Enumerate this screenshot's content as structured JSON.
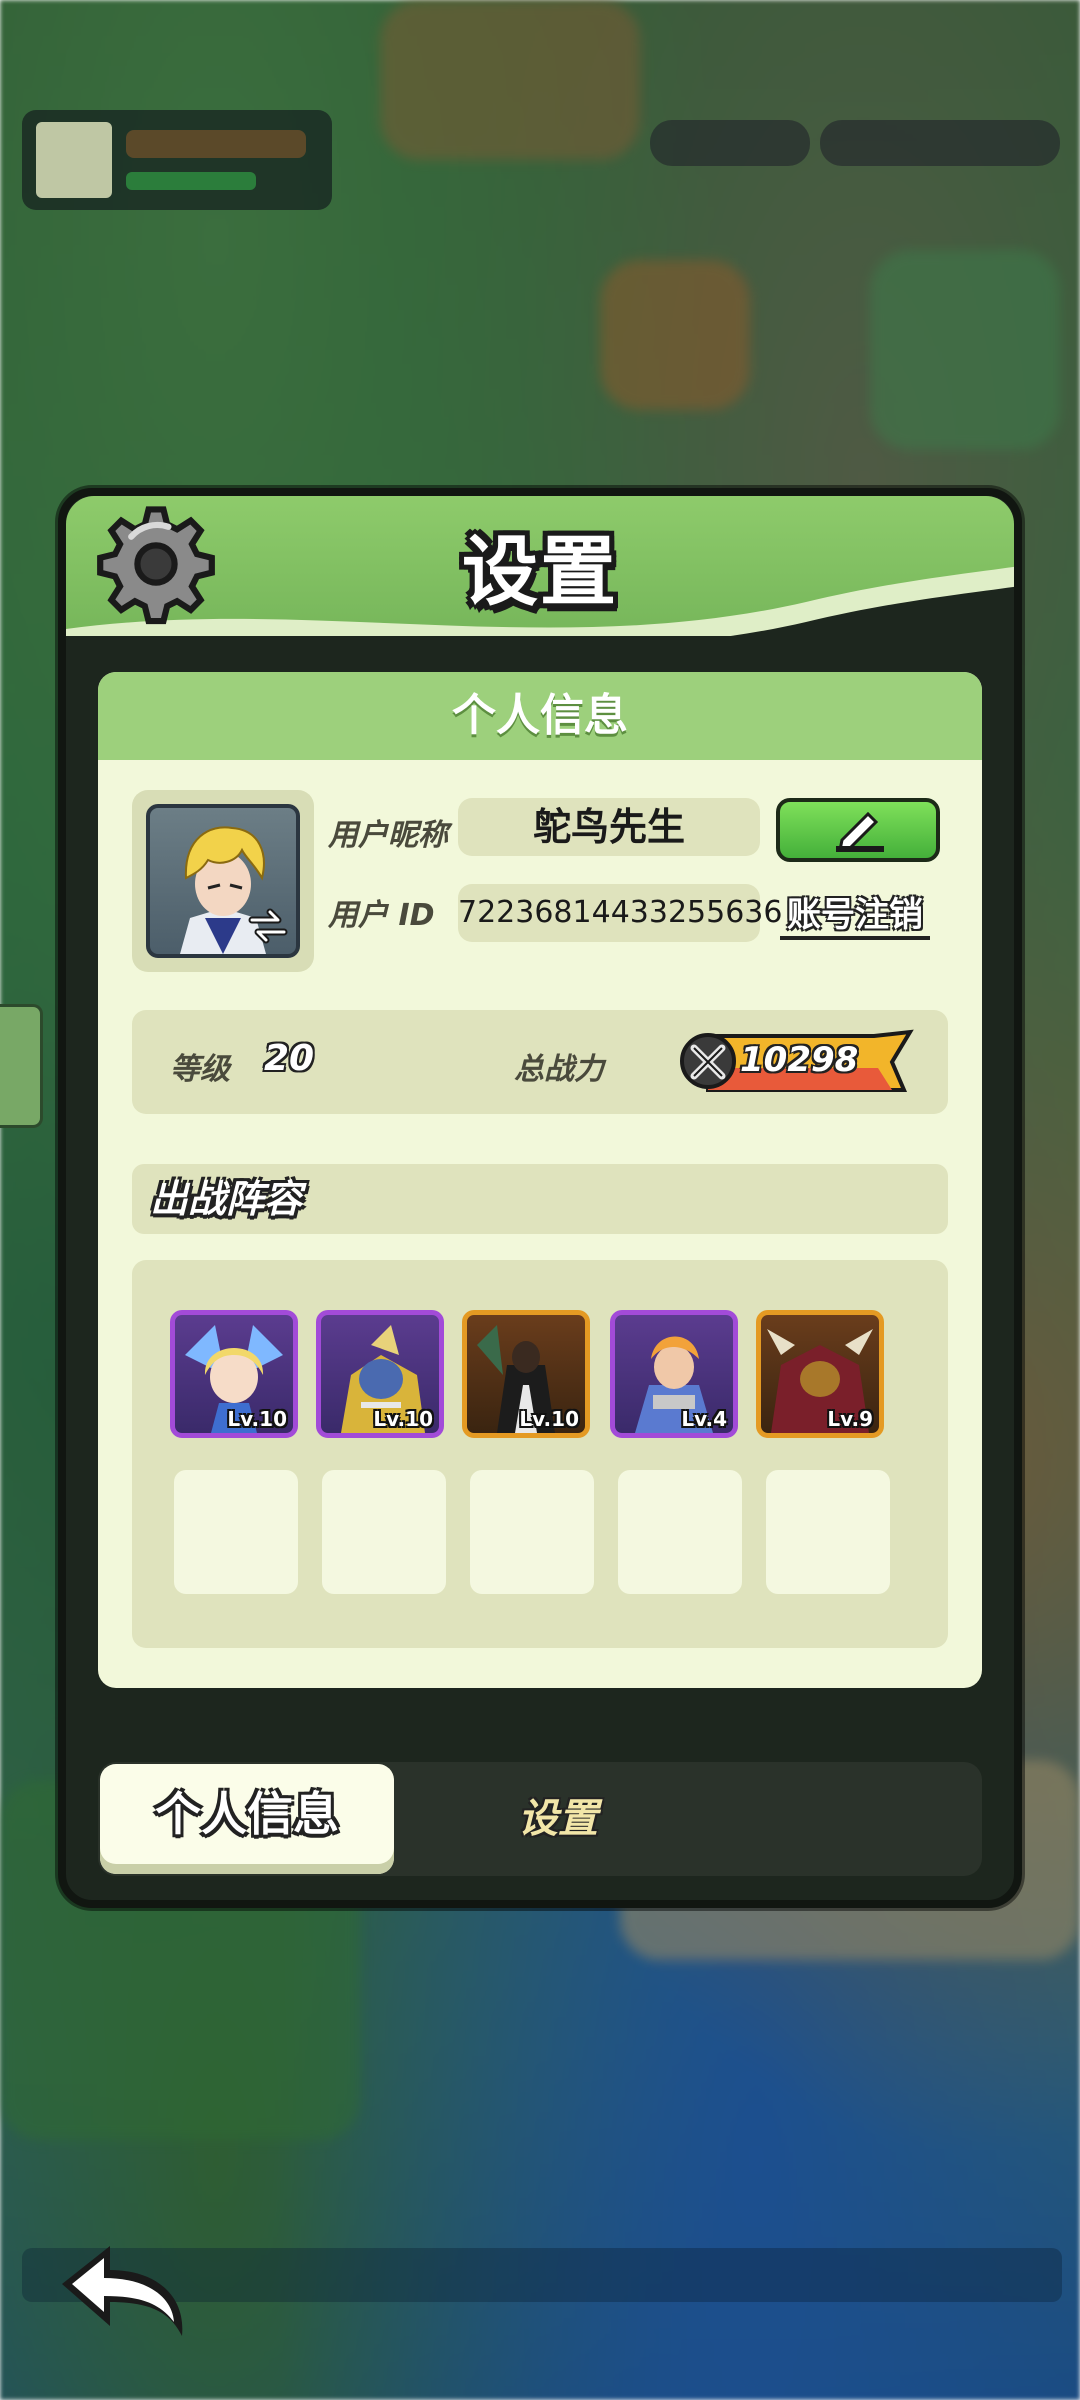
{
  "panel": {
    "title": "设置",
    "section_title": "个人信息"
  },
  "profile": {
    "nickname_label": "用户昵称",
    "nickname": "鸵鸟先生",
    "id_label": "用户 ID",
    "user_id": "72236814433255636",
    "delete_account_label": "账号注销"
  },
  "stats": {
    "level_label": "等级",
    "level": "20",
    "power_label": "总战力",
    "power": "10298"
  },
  "lineup": {
    "title": "出战阵容",
    "heroes": [
      {
        "level": "Lv.10",
        "rarity": "purple"
      },
      {
        "level": "Lv.10",
        "rarity": "purple"
      },
      {
        "level": "Lv.10",
        "rarity": "orange"
      },
      {
        "level": "Lv.4",
        "rarity": "purple"
      },
      {
        "level": "Lv.9",
        "rarity": "orange"
      }
    ],
    "empty_slots": 5
  },
  "tabs": [
    {
      "label": "个人信息",
      "active": true
    },
    {
      "label": "设置",
      "active": false
    }
  ],
  "colors": {
    "panel_green": "#8ecb6b",
    "card_bg": "#f2f8da",
    "edit_button": "#5ccb45",
    "purple_rarity": "#a24bd8",
    "orange_rarity": "#e49a23"
  },
  "icons": {
    "header": "gear-icon",
    "edit": "pencil-icon",
    "power": "crossed-swords-icon",
    "back": "back-arrow-icon"
  }
}
